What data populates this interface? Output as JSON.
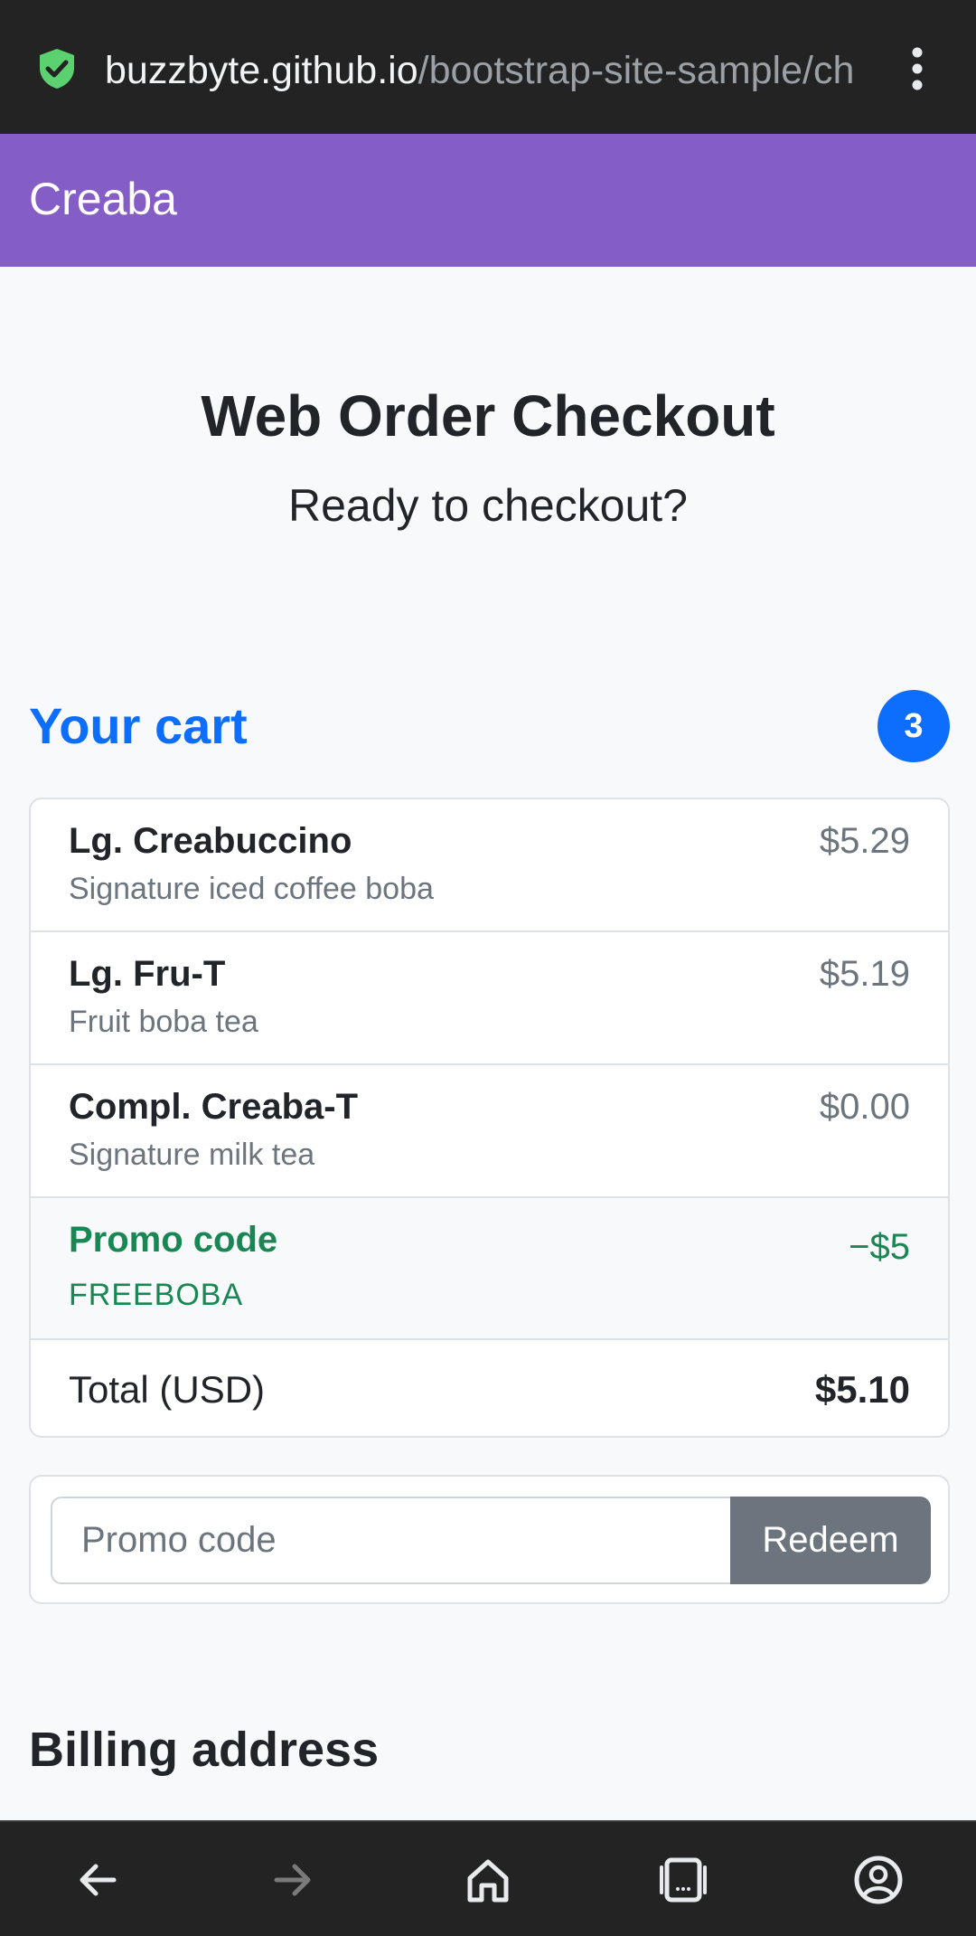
{
  "browser": {
    "url_host": "buzzbyte.github.io",
    "url_path": "/bootstrap-site-sample/ch",
    "security_icon": "shield-check-icon",
    "menu_icon": "kebab-menu-icon",
    "accent_color": "#5bd16f"
  },
  "navbar": {
    "brand": "Creaba",
    "color": "#855dc6"
  },
  "header": {
    "title": "Web Order Checkout",
    "lead": "Ready to checkout?"
  },
  "cart": {
    "heading": "Your cart",
    "count": "3",
    "items": [
      {
        "name": "Lg. Creabuccino",
        "desc": "Signature iced coffee boba",
        "price": "$5.29"
      },
      {
        "name": "Lg. Fru-T",
        "desc": "Fruit boba tea",
        "price": "$5.19"
      },
      {
        "name": "Compl. Creaba-T",
        "desc": "Signature milk tea",
        "price": "$0.00"
      }
    ],
    "promo": {
      "label": "Promo code",
      "code": "FREEBOBA",
      "amount": "−$5"
    },
    "total": {
      "label": "Total (USD)",
      "amount": "$5.10"
    }
  },
  "redeem": {
    "placeholder": "Promo code",
    "button": "Redeem"
  },
  "billing": {
    "heading": "Billing address"
  },
  "bottom_nav": {
    "icons": [
      "back-arrow-icon",
      "forward-arrow-icon",
      "home-icon",
      "tabs-icon",
      "account-icon"
    ]
  }
}
